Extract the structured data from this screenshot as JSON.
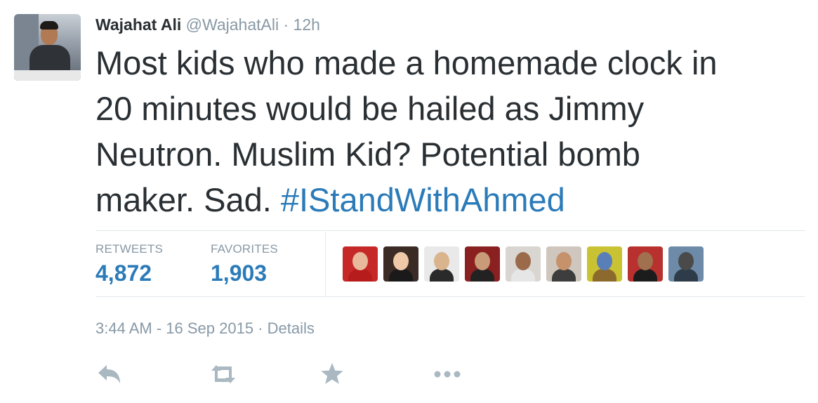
{
  "tweet": {
    "author": {
      "name": "Wajahat Ali",
      "handle": "@WajahatAli",
      "time_ago": "12h"
    },
    "separator": "·",
    "text_lines": [
      "Most kids who made a homemade clock in",
      "20 minutes would be hailed as Jimmy",
      "Neutron. Muslim Kid? Potential bomb"
    ],
    "text_last_prefix": "maker. Sad. ",
    "hashtag": "#IStandWithAhmed",
    "stats": {
      "retweets_label": "RETWEETS",
      "retweets_count": "4,872",
      "favorites_label": "FAVORITES",
      "favorites_count": "1,903"
    },
    "timestamp": "3:44 AM - 16 Sep 2015",
    "details_link": "Details"
  },
  "faces": [
    {
      "icon": "favoriter-avatar",
      "bg": "#c62828",
      "head": "#e8b99a",
      "body": "#b71c1c"
    },
    {
      "icon": "favoriter-avatar",
      "bg": "#3a2b24",
      "head": "#f0c9a8",
      "body": "#1a1a1a"
    },
    {
      "icon": "favoriter-avatar",
      "bg": "#e9e9e9",
      "head": "#d9b48c",
      "body": "#2a2a2a"
    },
    {
      "icon": "favoriter-avatar",
      "bg": "#8a2020",
      "head": "#c99b78",
      "body": "#222222"
    },
    {
      "icon": "favoriter-avatar",
      "bg": "#d9d6d2",
      "head": "#9a6a4a",
      "body": "#e6e6e6"
    },
    {
      "icon": "favoriter-avatar",
      "bg": "#cfc6bd",
      "head": "#c6926c",
      "body": "#3d3d3d"
    },
    {
      "icon": "favoriter-avatar",
      "bg": "#c9c233",
      "head": "#5a7fb8",
      "body": "#8c6a2e"
    },
    {
      "icon": "favoriter-avatar",
      "bg": "#b8312f",
      "head": "#a0704f",
      "body": "#1c1c1c"
    },
    {
      "icon": "favoriter-avatar",
      "bg": "#6d8aa8",
      "head": "#4a4a4a",
      "body": "#2e3b48"
    }
  ],
  "icons": {
    "reply": "reply-icon",
    "retweet": "retweet-icon",
    "favorite": "star-icon",
    "more": "more-icon"
  },
  "colors": {
    "link": "#2b7bb9",
    "muted": "#8899a6",
    "text": "#292f33",
    "icon": "#aab8c2"
  }
}
